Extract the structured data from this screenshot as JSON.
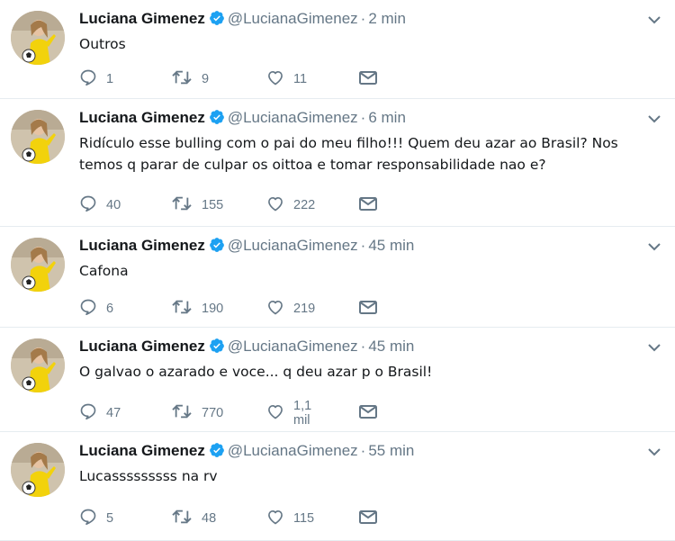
{
  "tweets": [
    {
      "name": "Luciana Gimenez",
      "handle": "@LucianaGimenez",
      "separator": "·",
      "time": "2 min",
      "text": "Outros",
      "replies": "1",
      "retweets": "9",
      "likes": "11"
    },
    {
      "name": "Luciana Gimenez",
      "handle": "@LucianaGimenez",
      "separator": "·",
      "time": "6 min",
      "text": "Ridículo esse bulling com o pai do meu filho!!! Quem deu azar ao Brasil? Nos temos q parar de culpar os oittoa e tomar responsabilidade nao e?",
      "replies": "40",
      "retweets": "155",
      "likes": "222"
    },
    {
      "name": "Luciana Gimenez",
      "handle": "@LucianaGimenez",
      "separator": "·",
      "time": "45 min",
      "text": "Cafona",
      "replies": "6",
      "retweets": "190",
      "likes": "219"
    },
    {
      "name": "Luciana Gimenez",
      "handle": "@LucianaGimenez",
      "separator": "·",
      "time": "45 min",
      "text": "O galvao o azarado e voce... q deu azar p o Brasil!",
      "replies": "47",
      "retweets": "770",
      "likes": "1,1 mil"
    },
    {
      "name": "Luciana Gimenez",
      "handle": "@LucianaGimenez",
      "separator": "·",
      "time": "55 min",
      "text": "Lucasssssssss na rv",
      "replies": "5",
      "retweets": "48",
      "likes": "115"
    }
  ],
  "icons": {
    "reply": "reply-icon",
    "retweet": "retweet-icon",
    "like": "heart-icon",
    "dm": "envelope-icon",
    "verified": "verified-badge-icon",
    "caret": "chevron-down-icon"
  },
  "colors": {
    "name": "#14171a",
    "meta": "#657786",
    "verified": "#1da1f2",
    "divider": "#e6ecf0"
  }
}
